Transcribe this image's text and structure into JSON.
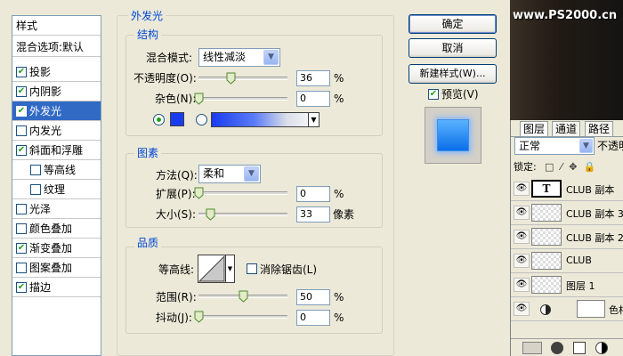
{
  "style_list": {
    "header": "样式",
    "blend_options": "混合选项:默认",
    "items": [
      {
        "label": "投影",
        "checked": true
      },
      {
        "label": "内阴影",
        "checked": true
      },
      {
        "label": "外发光",
        "checked": true,
        "selected": true
      },
      {
        "label": "内发光",
        "checked": false
      },
      {
        "label": "斜面和浮雕",
        "checked": true
      },
      {
        "label": "等高线",
        "checked": false,
        "indent": true
      },
      {
        "label": "纹理",
        "checked": false,
        "indent": true
      },
      {
        "label": "光泽",
        "checked": false
      },
      {
        "label": "颜色叠加",
        "checked": false
      },
      {
        "label": "渐变叠加",
        "checked": true
      },
      {
        "label": "图案叠加",
        "checked": false
      },
      {
        "label": "描边",
        "checked": true
      }
    ]
  },
  "outer_glow": {
    "title": "外发光",
    "structure": {
      "title": "结构",
      "blend_mode_label": "混合模式:",
      "blend_mode": "线性减淡",
      "opacity_label": "不透明度(O):",
      "opacity": "36",
      "opacity_fraction": 0.36,
      "noise_label": "杂色(N):",
      "noise": "0",
      "noise_fraction": 0.0,
      "percent": "%",
      "color_mode": "solid",
      "glow_color": "#1a3cf0"
    },
    "elements": {
      "title": "图素",
      "technique_label": "方法(Q):",
      "technique": "柔和",
      "spread_label": "扩展(P):",
      "spread": "0",
      "spread_fraction": 0.0,
      "size_label": "大小(S):",
      "size": "33",
      "size_fraction": 0.132,
      "size_unit": "像素",
      "percent": "%"
    },
    "quality": {
      "title": "品质",
      "contour_label": "等高线:",
      "antialias_label": "消除锯齿(L)",
      "antialias_checked": false,
      "range_label": "范围(R):",
      "range": "50",
      "range_fraction": 0.5,
      "jitter_label": "抖动(J):",
      "jitter": "0",
      "jitter_fraction": 0.0,
      "percent": "%"
    }
  },
  "buttons": {
    "ok": "确定",
    "cancel": "取消",
    "new_style": "新建样式(W)...",
    "preview_label": "预览(V)",
    "preview_checked": true
  },
  "watermark": "www.PS2000.cn",
  "layers": {
    "tabs": [
      "图层",
      "通道",
      "路径"
    ],
    "blend_mode": "正常",
    "opacity_label": "不透明",
    "lock_label": "锁定:",
    "items": [
      {
        "name": "CLUB 副本",
        "type": "text"
      },
      {
        "name": "CLUB 副本 3",
        "type": "pixel"
      },
      {
        "name": "CLUB 副本 2",
        "type": "pixel"
      },
      {
        "name": "CLUB",
        "type": "pixel"
      },
      {
        "name": "图层 1",
        "type": "pixel"
      },
      {
        "name": "色相",
        "type": "adjustment"
      }
    ]
  },
  "colors": {
    "accent": "#0046d5",
    "selection": "#316ac5",
    "glow": "#1a3cf0"
  }
}
